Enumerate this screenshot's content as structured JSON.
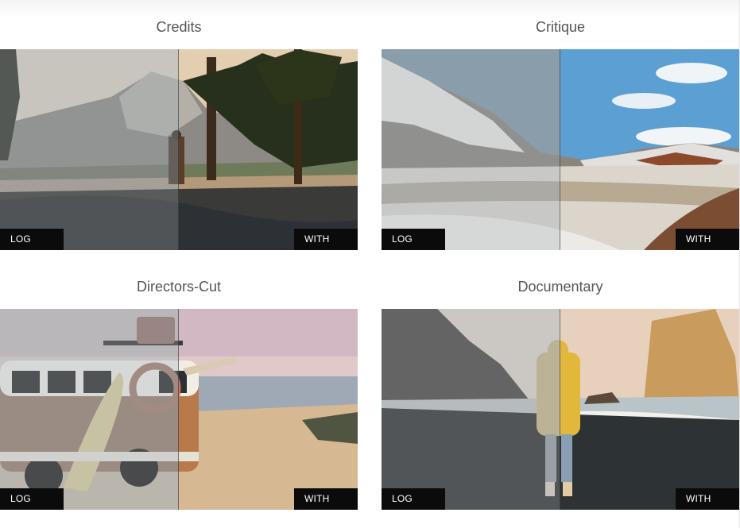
{
  "cards": [
    {
      "title": "Credits",
      "log_label": "LOG FILE",
      "lut_label": "WITH LUT"
    },
    {
      "title": "Critique",
      "log_label": "LOG FILE",
      "lut_label": "WITH LUT"
    },
    {
      "title": "Directors-Cut",
      "log_label": "LOG FILE",
      "lut_label": "WITH LUT"
    },
    {
      "title": "Documentary",
      "log_label": "LOG FILE",
      "lut_label": "WITH LUT"
    }
  ]
}
